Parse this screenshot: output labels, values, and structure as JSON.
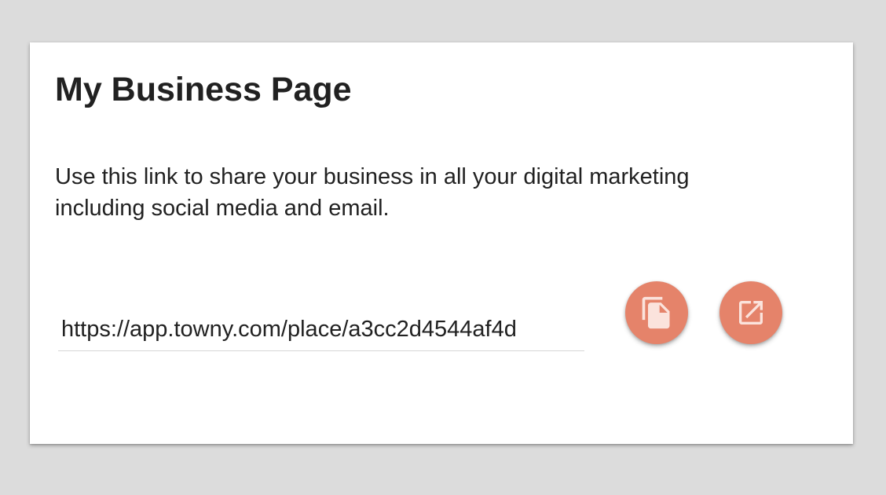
{
  "card": {
    "title": "My Business Page",
    "description": "Use this link to share your business in all your digital marketing including social media and email."
  },
  "share_link": {
    "value": "https://app.towny.com/place/a3cc2d4544af4d"
  },
  "actions": {
    "copy_icon": "copy-icon",
    "open_icon": "open-in-new-icon"
  },
  "colors": {
    "background": "#dcdcdc",
    "card": "#ffffff",
    "accent": "#e5836a",
    "text": "#212121"
  }
}
